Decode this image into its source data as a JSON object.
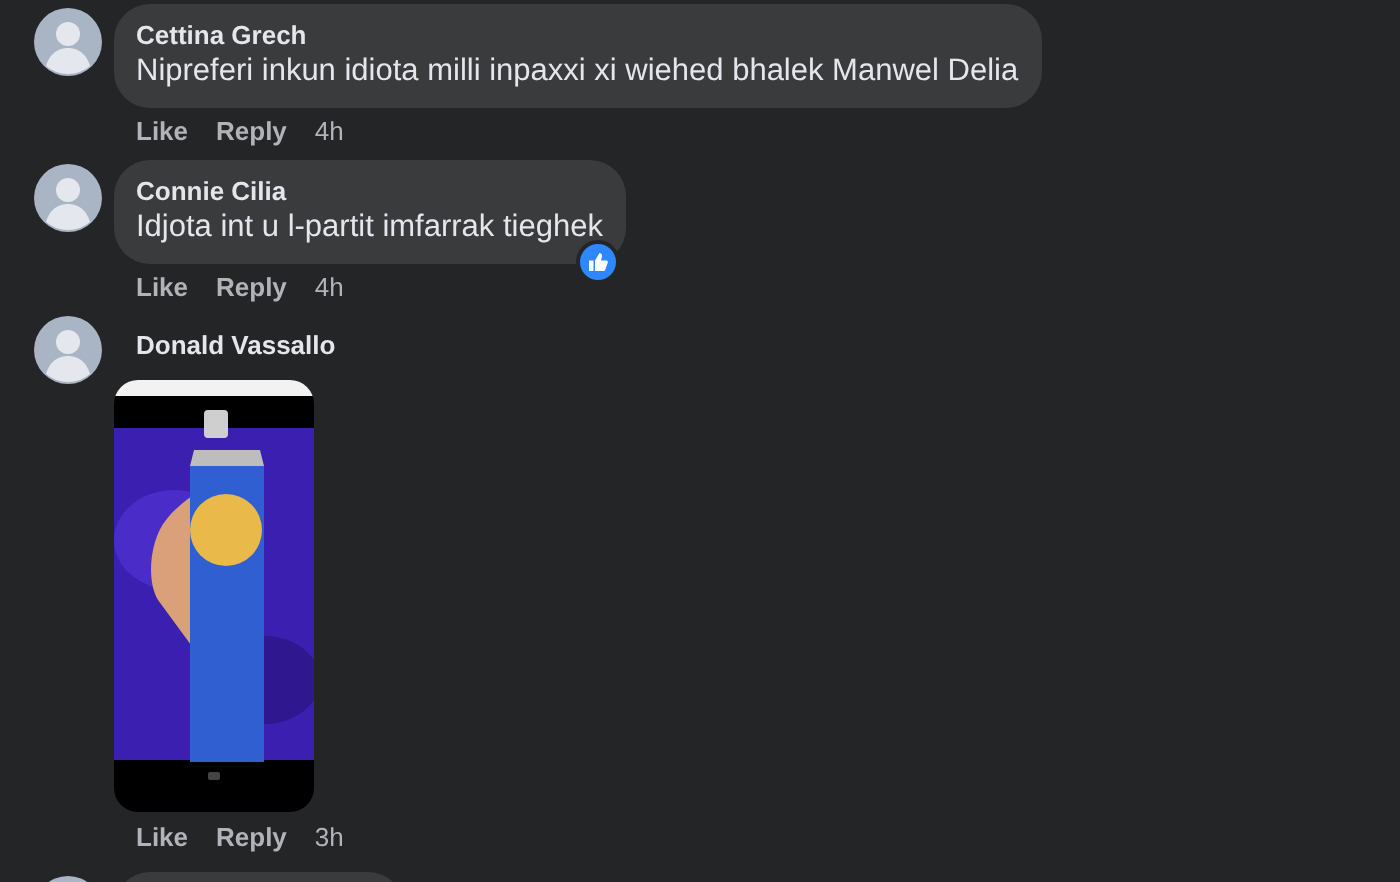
{
  "comments": [
    {
      "kind": "text",
      "author": "Cettina Grech",
      "text": "Nipreferi inkun idiota milli inpaxxi xi wiehed bhalek Manwel Delia",
      "liked": false,
      "actions": {
        "like": "Like",
        "reply": "Reply",
        "time": "4h"
      }
    },
    {
      "kind": "text",
      "author": "Connie Cilia",
      "text": "Idjota int u l-partit imfarrak tieghek",
      "liked": true,
      "actions": {
        "like": "Like",
        "reply": "Reply",
        "time": "4h"
      }
    },
    {
      "author": "Donald Vassallo",
      "liked": false,
      "actions": {
        "like": "Like",
        "reply": "Reply",
        "time": "3h"
      }
    },
    {
      "kind": "cut"
    }
  ]
}
